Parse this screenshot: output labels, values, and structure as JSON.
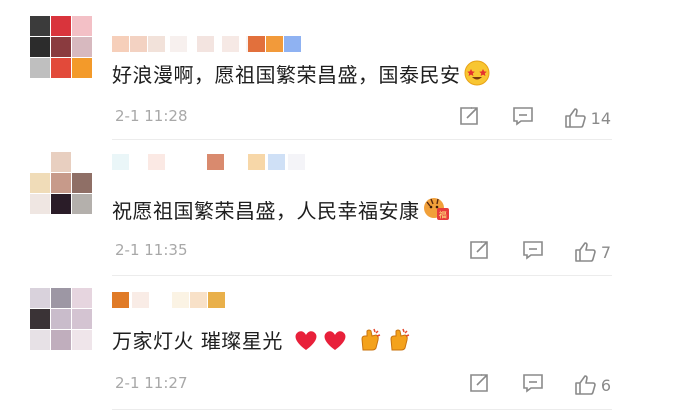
{
  "comments": [
    {
      "text": "好浪漫啊，愿祖国繁荣昌盛，国泰民安",
      "emojis": [
        "star-struck-emoji"
      ],
      "time": "2-1 11:28",
      "likes": "14"
    },
    {
      "text": "祝愿祖国繁荣昌盛，人民幸福安康",
      "emojis": [
        "tiger-fu-emoji"
      ],
      "time": "2-1 11:35",
      "likes": "7"
    },
    {
      "text": "万家灯火 璀璨星光",
      "emojis": [
        "red-heart-emoji",
        "red-heart-emoji",
        "clap-emoji",
        "clap-emoji"
      ],
      "time": "2-1 11:27",
      "likes": "6"
    }
  ],
  "icons": {
    "share": "share-icon",
    "reply": "comment-reply-icon",
    "like": "thumbs-up-icon"
  },
  "colors": {
    "text": "#1e1e1e",
    "meta": "#a8a8a8",
    "icon": "#8a8a8a",
    "heart": "#e8203a",
    "clap": "#f4a21c"
  }
}
